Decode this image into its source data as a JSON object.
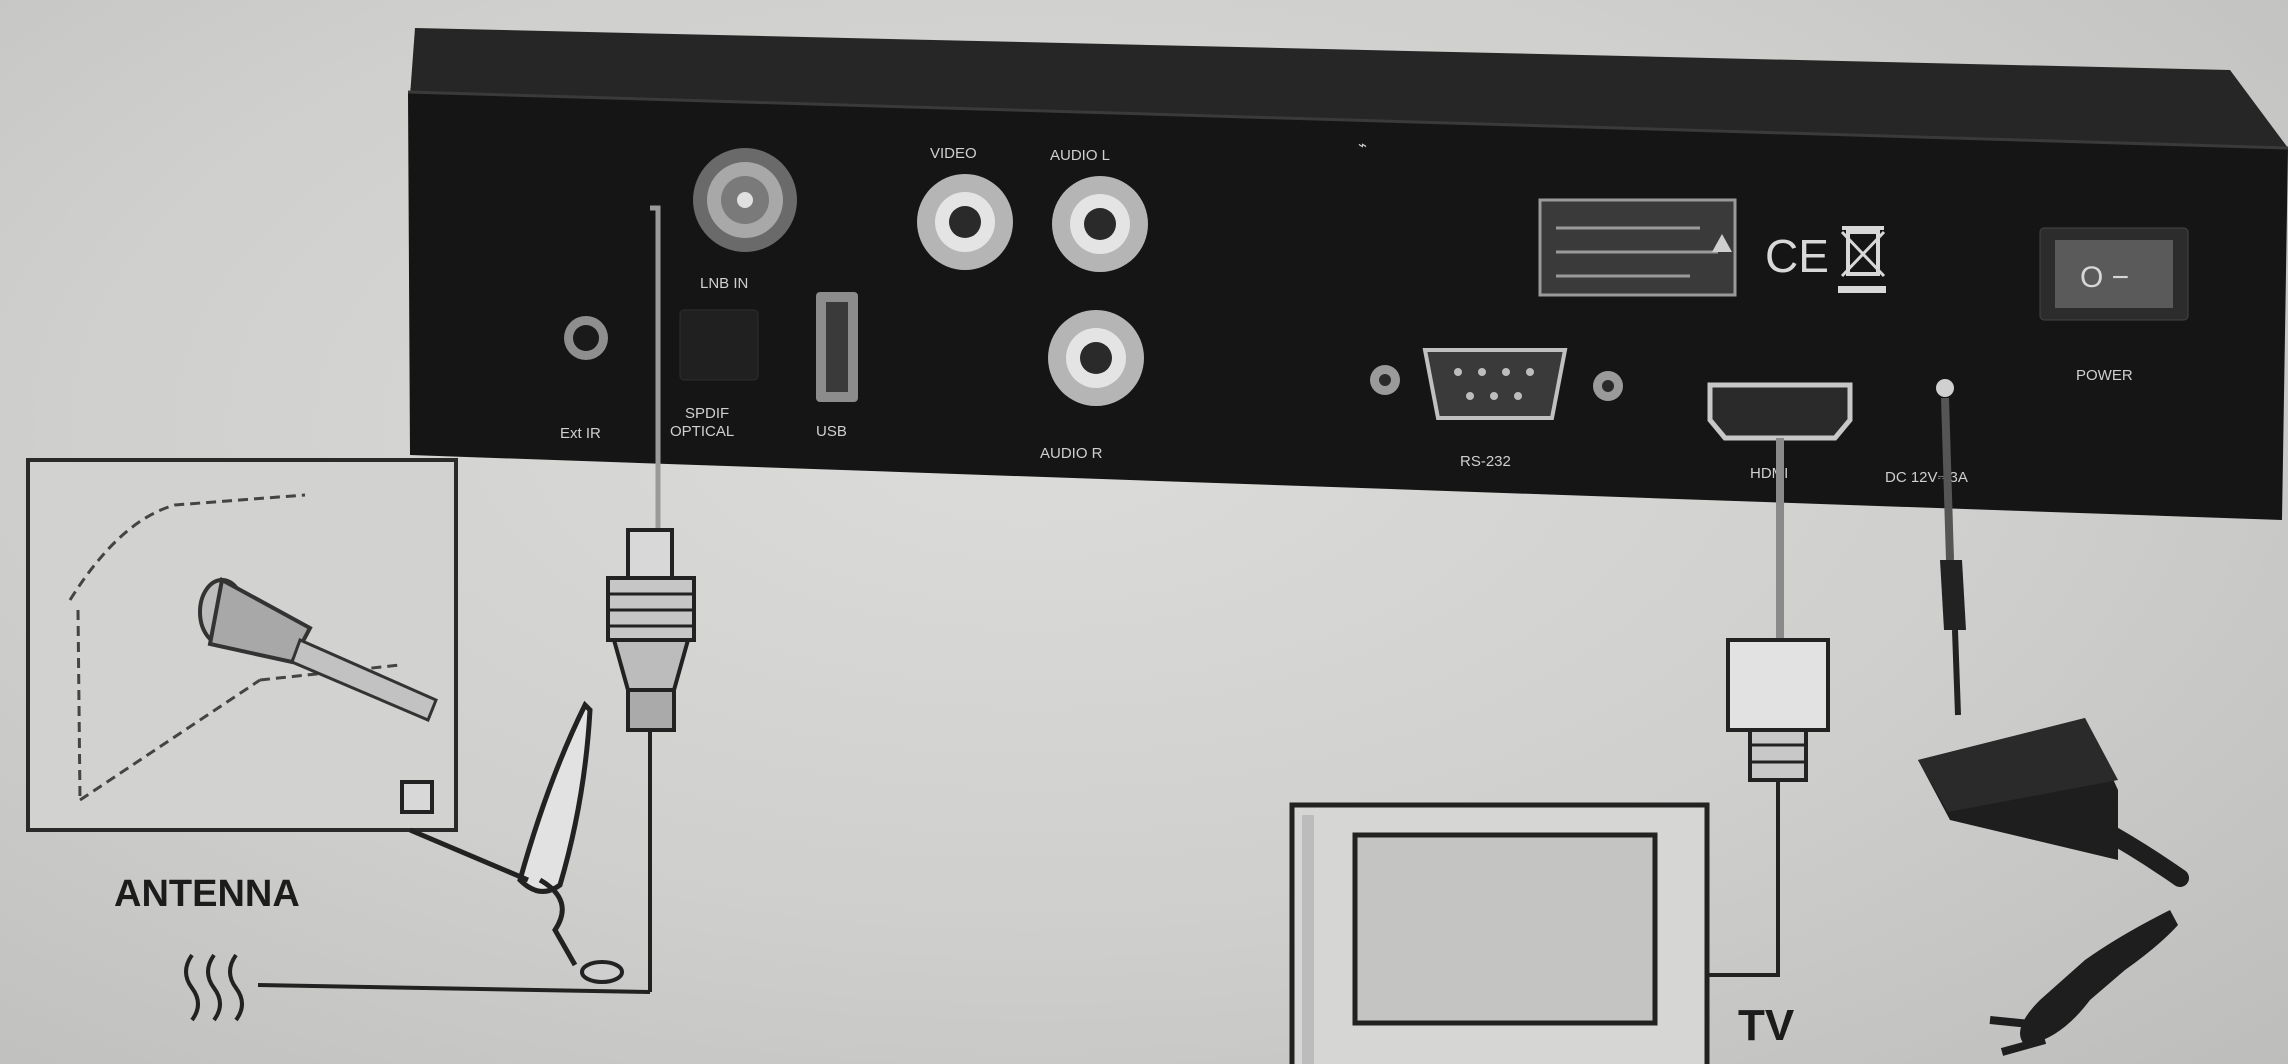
{
  "receiver": {
    "port_labels": {
      "ext_ir": "Ext IR",
      "lnb_in": "LNB IN",
      "spdif": "SPDIF",
      "optical": "OPTICAL",
      "usb": "USB",
      "video": "VIDEO",
      "audio_l": "AUDIO L",
      "audio_r": "AUDIO R",
      "rs232": "RS-232",
      "hdmi": "HDMI",
      "dc_in": "DC 12V⎓3A",
      "power": "POWER"
    },
    "power_switch_symbols": "O −",
    "certification_marks": "CE"
  },
  "callouts": {
    "antenna": "ANTENNA",
    "tv": "TV"
  },
  "colors": {
    "background": "#d2d2d0",
    "device_body": "#1b1b1b",
    "line_art": "#222222",
    "label_text": "#cfcfcf"
  }
}
